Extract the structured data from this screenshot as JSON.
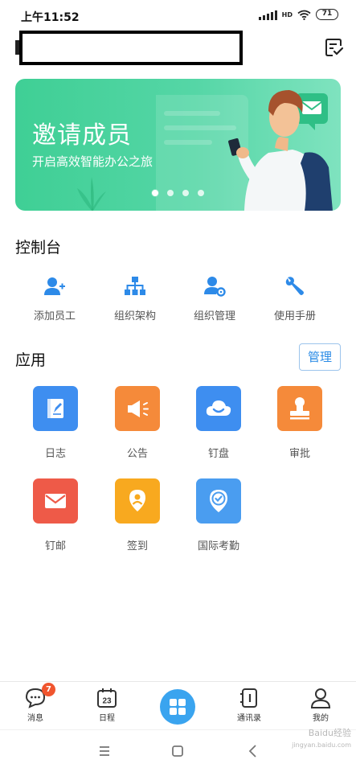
{
  "status_bar": {
    "time": "上午11:52",
    "network_label": "HD",
    "battery": "71"
  },
  "header": {
    "org_name": ""
  },
  "banner": {
    "title": "邀请成员",
    "subtitle": "开启高效智能办公之旅",
    "slide_count": 4,
    "active_slide": 1
  },
  "console": {
    "title": "控制台",
    "items": [
      {
        "label": "添加员工",
        "icon": "add-user-icon"
      },
      {
        "label": "组织架构",
        "icon": "org-chart-icon"
      },
      {
        "label": "组织管理",
        "icon": "user-gear-icon"
      },
      {
        "label": "使用手册",
        "icon": "wrench-icon"
      }
    ]
  },
  "apps": {
    "title": "应用",
    "manage_label": "管理",
    "items": [
      {
        "label": "日志",
        "icon": "log-icon",
        "color": "#3e8ef0"
      },
      {
        "label": "公告",
        "icon": "megaphone-icon",
        "color": "#f58a3a"
      },
      {
        "label": "钉盘",
        "icon": "cloud-icon",
        "color": "#3e8ef0"
      },
      {
        "label": "审批",
        "icon": "stamp-icon",
        "color": "#f58a3a"
      },
      {
        "label": "钉邮",
        "icon": "mail-icon",
        "color": "#ee5a48"
      },
      {
        "label": "签到",
        "icon": "location-icon",
        "color": "#f8a91f"
      },
      {
        "label": "国际考勤",
        "icon": "check-pin-icon",
        "color": "#4a9df0"
      }
    ]
  },
  "bottom_nav": {
    "items": [
      {
        "label": "消息",
        "icon": "chat-icon",
        "badge": "7"
      },
      {
        "label": "日程",
        "icon": "calendar-icon",
        "date": "23"
      },
      {
        "label": "",
        "icon": "workbench-icon"
      },
      {
        "label": "通讯录",
        "icon": "contacts-icon"
      },
      {
        "label": "我的",
        "icon": "profile-icon"
      }
    ]
  },
  "colors": {
    "accent": "#3aa4ef",
    "banner": "#45d09a",
    "badge": "#f0552e"
  },
  "watermark": {
    "line1": "Baidu经验",
    "line2": "jingyan.baidu.com"
  }
}
